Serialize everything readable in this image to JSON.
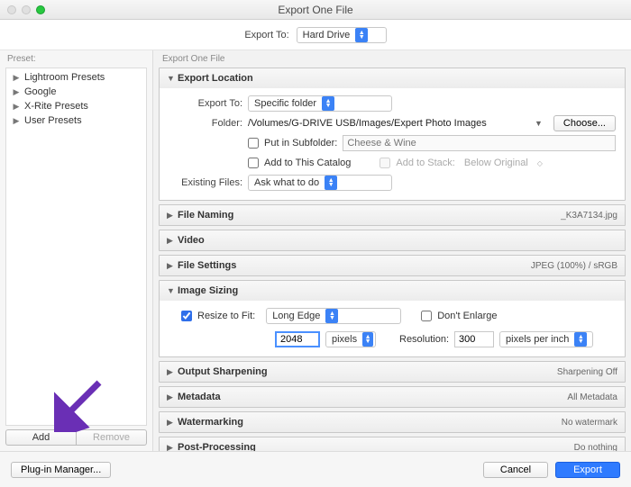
{
  "window": {
    "title": "Export One File"
  },
  "top": {
    "export_to_label": "Export To:",
    "export_to_value": "Hard Drive"
  },
  "sidebar": {
    "header": "Preset:",
    "items": [
      "Lightroom Presets",
      "Google",
      "X-Rite Presets",
      "User Presets"
    ],
    "add_label": "Add",
    "remove_label": "Remove"
  },
  "main": {
    "header": "Export One File",
    "sections": {
      "location": {
        "title": "Export Location",
        "export_to_label": "Export To:",
        "export_to_value": "Specific folder",
        "folder_label": "Folder:",
        "folder_value": "/Volumes/G-DRIVE USB/Images/Expert Photo Images",
        "choose_label": "Choose...",
        "subfolder_label": "Put in Subfolder:",
        "subfolder_placeholder": "Cheese & Wine",
        "addcatalog_label": "Add to This Catalog",
        "addstack_label": "Add to Stack:",
        "addstack_value": "Below Original",
        "existing_label": "Existing Files:",
        "existing_value": "Ask what to do"
      },
      "file_naming": {
        "title": "File Naming",
        "summary": "_K3A7134.jpg"
      },
      "video": {
        "title": "Video",
        "summary": ""
      },
      "file_settings": {
        "title": "File Settings",
        "summary": "JPEG (100%) / sRGB"
      },
      "sizing": {
        "title": "Image Sizing",
        "resize_label": "Resize to Fit:",
        "resize_value": "Long Edge",
        "dont_enlarge_label": "Don't Enlarge",
        "size_value": "2048",
        "size_units": "pixels",
        "resolution_label": "Resolution:",
        "resolution_value": "300",
        "resolution_units": "pixels per inch"
      },
      "sharpen": {
        "title": "Output Sharpening",
        "summary": "Sharpening Off"
      },
      "metadata": {
        "title": "Metadata",
        "summary": "All Metadata"
      },
      "watermark": {
        "title": "Watermarking",
        "summary": "No watermark"
      },
      "postprocess": {
        "title": "Post-Processing",
        "summary": "Do nothing"
      }
    }
  },
  "bottom": {
    "plugin_label": "Plug-in Manager...",
    "cancel_label": "Cancel",
    "export_label": "Export"
  }
}
